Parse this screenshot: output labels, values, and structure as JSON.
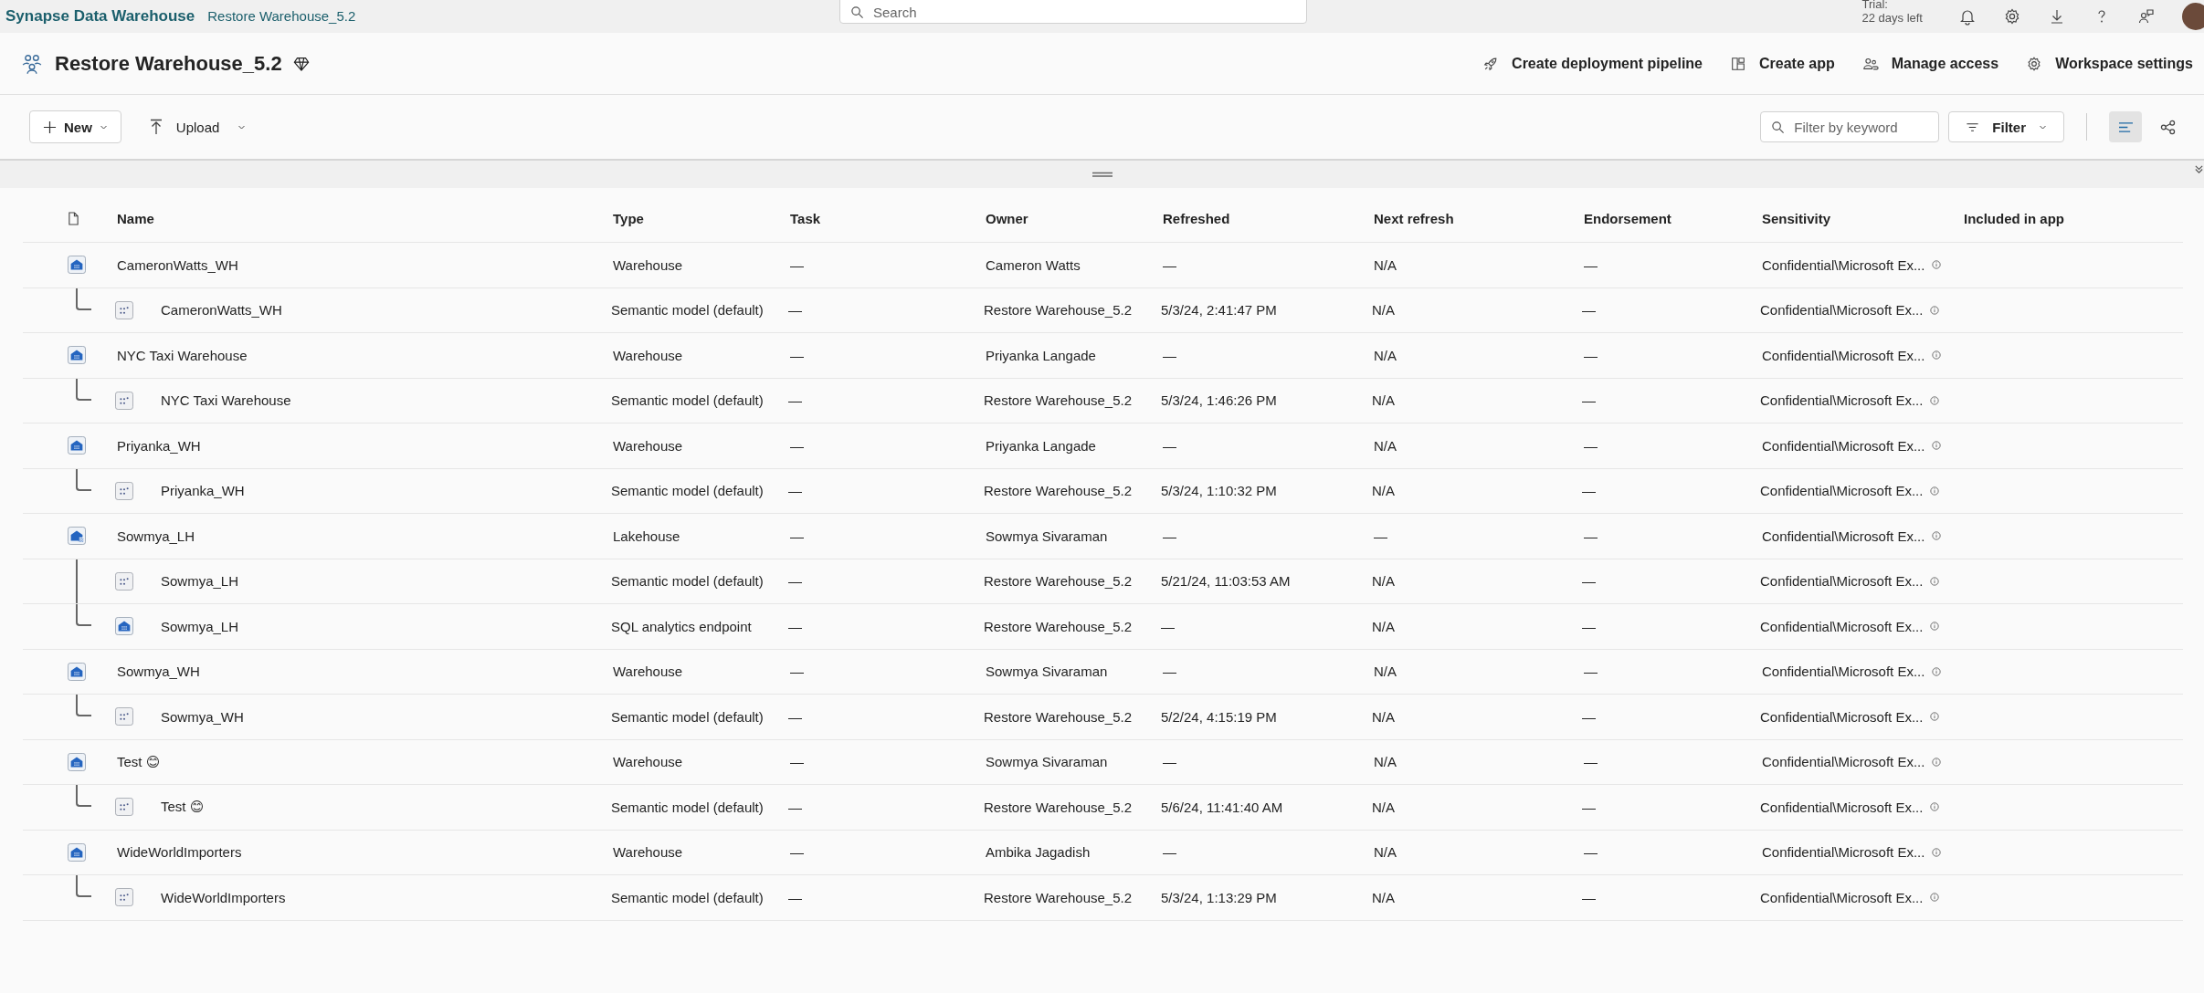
{
  "app": {
    "name": "Synapse Data Warehouse",
    "workspace": "Restore Warehouse_5.2"
  },
  "search": {
    "placeholder": "Search"
  },
  "trial": {
    "label": "Trial:",
    "days": "22 days left"
  },
  "workspace": {
    "title": "Restore Warehouse_5.2",
    "actions": [
      {
        "kind": "rocket",
        "label": "Create deployment pipeline"
      },
      {
        "kind": "app",
        "label": "Create app"
      },
      {
        "kind": "people",
        "label": "Manage access"
      },
      {
        "kind": "gear",
        "label": "Workspace settings"
      }
    ]
  },
  "toolbar": {
    "new": "New",
    "upload": "Upload",
    "filter_field": {
      "placeholder": "Filter by keyword"
    },
    "filter": "Filter",
    "views": [
      {
        "kind": "list",
        "selected": true
      },
      {
        "kind": "lineage",
        "selected": false
      }
    ]
  },
  "table": {
    "columns": [
      "Name",
      "Type",
      "Task",
      "Owner",
      "Refreshed",
      "Next refresh",
      "Endorsement",
      "Sensitivity",
      "Included in app"
    ],
    "rows": [
      {
        "kind": "warehouse",
        "name": "CameronWatts_WH",
        "type": "Warehouse",
        "task": "—",
        "owner": "Cameron Watts",
        "refreshed": "—",
        "next_refresh": "N/A",
        "endorsement": "—",
        "sensitivity": "Confidential\\Microsoft Ex...",
        "children": [
          {
            "kind": "semantic",
            "name": "CameronWatts_WH",
            "type": "Semantic model (default)",
            "task": "—",
            "owner": "Restore Warehouse_5.2",
            "refreshed": "5/3/24, 2:41:47 PM",
            "next_refresh": "N/A",
            "endorsement": "—",
            "sensitivity": "Confidential\\Microsoft Ex..."
          }
        ]
      },
      {
        "kind": "warehouse",
        "name": "NYC Taxi Warehouse",
        "type": "Warehouse",
        "task": "—",
        "owner": "Priyanka Langade",
        "refreshed": "—",
        "next_refresh": "N/A",
        "endorsement": "—",
        "sensitivity": "Confidential\\Microsoft Ex...",
        "children": [
          {
            "kind": "semantic",
            "name": "NYC Taxi Warehouse",
            "type": "Semantic model (default)",
            "task": "—",
            "owner": "Restore Warehouse_5.2",
            "refreshed": "5/3/24, 1:46:26 PM",
            "next_refresh": "N/A",
            "endorsement": "—",
            "sensitivity": "Confidential\\Microsoft Ex..."
          }
        ]
      },
      {
        "kind": "warehouse",
        "name": "Priyanka_WH",
        "type": "Warehouse",
        "task": "—",
        "owner": "Priyanka Langade",
        "refreshed": "—",
        "next_refresh": "N/A",
        "endorsement": "—",
        "sensitivity": "Confidential\\Microsoft Ex...",
        "children": [
          {
            "kind": "semantic",
            "name": "Priyanka_WH",
            "type": "Semantic model (default)",
            "task": "—",
            "owner": "Restore Warehouse_5.2",
            "refreshed": "5/3/24, 1:10:32 PM",
            "next_refresh": "N/A",
            "endorsement": "—",
            "sensitivity": "Confidential\\Microsoft Ex..."
          }
        ]
      },
      {
        "kind": "lakehouse",
        "name": "Sowmya_LH",
        "type": "Lakehouse",
        "task": "—",
        "owner": "Sowmya Sivaraman",
        "refreshed": "—",
        "next_refresh": "—",
        "endorsement": "—",
        "sensitivity": "Confidential\\Microsoft Ex...",
        "children": [
          {
            "kind": "semantic",
            "name": "Sowmya_LH",
            "type": "Semantic model (default)",
            "task": "—",
            "owner": "Restore Warehouse_5.2",
            "refreshed": "5/21/24, 11:03:53 AM",
            "next_refresh": "N/A",
            "endorsement": "—",
            "sensitivity": "Confidential\\Microsoft Ex..."
          },
          {
            "kind": "endpoint",
            "name": "Sowmya_LH",
            "type": "SQL analytics endpoint",
            "task": "—",
            "owner": "Restore Warehouse_5.2",
            "refreshed": "—",
            "next_refresh": "N/A",
            "endorsement": "—",
            "sensitivity": "Confidential\\Microsoft Ex..."
          }
        ]
      },
      {
        "kind": "warehouse",
        "name": "Sowmya_WH",
        "type": "Warehouse",
        "task": "—",
        "owner": "Sowmya Sivaraman",
        "refreshed": "—",
        "next_refresh": "N/A",
        "endorsement": "—",
        "sensitivity": "Confidential\\Microsoft Ex...",
        "children": [
          {
            "kind": "semantic",
            "name": "Sowmya_WH",
            "type": "Semantic model (default)",
            "task": "—",
            "owner": "Restore Warehouse_5.2",
            "refreshed": "5/2/24, 4:15:19 PM",
            "next_refresh": "N/A",
            "endorsement": "—",
            "sensitivity": "Confidential\\Microsoft Ex..."
          }
        ]
      },
      {
        "kind": "warehouse",
        "name": "Test 😊",
        "type": "Warehouse",
        "task": "—",
        "owner": "Sowmya Sivaraman",
        "refreshed": "—",
        "next_refresh": "N/A",
        "endorsement": "—",
        "sensitivity": "Confidential\\Microsoft Ex...",
        "children": [
          {
            "kind": "semantic",
            "name": "Test 😊",
            "type": "Semantic model (default)",
            "task": "—",
            "owner": "Restore Warehouse_5.2",
            "refreshed": "5/6/24, 11:41:40 AM",
            "next_refresh": "N/A",
            "endorsement": "—",
            "sensitivity": "Confidential\\Microsoft Ex..."
          }
        ]
      },
      {
        "kind": "warehouse",
        "name": "WideWorldImporters",
        "type": "Warehouse",
        "task": "—",
        "owner": "Ambika Jagadish",
        "refreshed": "—",
        "next_refresh": "N/A",
        "endorsement": "—",
        "sensitivity": "Confidential\\Microsoft Ex...",
        "children": [
          {
            "kind": "semantic",
            "name": "WideWorldImporters",
            "type": "Semantic model (default)",
            "task": "—",
            "owner": "Restore Warehouse_5.2",
            "refreshed": "5/3/24, 1:13:29 PM",
            "next_refresh": "N/A",
            "endorsement": "—",
            "sensitivity": "Confidential\\Microsoft Ex..."
          }
        ]
      }
    ]
  }
}
